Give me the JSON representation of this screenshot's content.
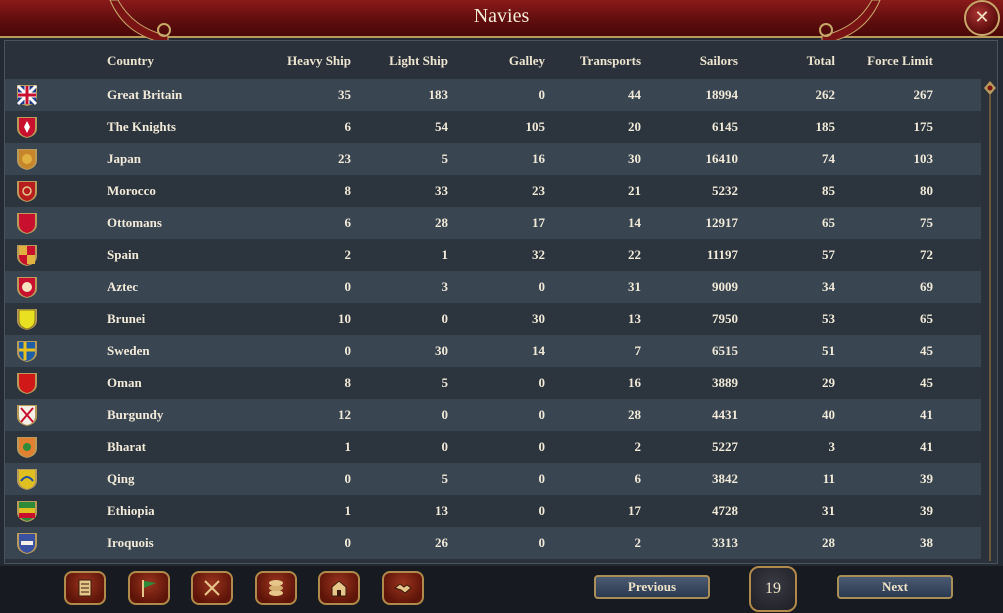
{
  "window": {
    "title": "Navies"
  },
  "columns": [
    "Country",
    "Heavy Ship",
    "Light Ship",
    "Galley",
    "Transports",
    "Sailors",
    "Total",
    "Force Limit"
  ],
  "rows": [
    {
      "flag": "great-britain-flag-icon",
      "country": "Great Britain",
      "heavy": "35",
      "light": "183",
      "galley": "0",
      "transports": "44",
      "sailors": "18994",
      "total": "262",
      "force_limit": "267"
    },
    {
      "flag": "knights-flag-icon",
      "country": "The Knights",
      "heavy": "6",
      "light": "54",
      "galley": "105",
      "transports": "20",
      "sailors": "6145",
      "total": "185",
      "force_limit": "175"
    },
    {
      "flag": "japan-flag-icon",
      "country": "Japan",
      "heavy": "23",
      "light": "5",
      "galley": "16",
      "transports": "30",
      "sailors": "16410",
      "total": "74",
      "force_limit": "103"
    },
    {
      "flag": "morocco-flag-icon",
      "country": "Morocco",
      "heavy": "8",
      "light": "33",
      "galley": "23",
      "transports": "21",
      "sailors": "5232",
      "total": "85",
      "force_limit": "80"
    },
    {
      "flag": "ottomans-flag-icon",
      "country": "Ottomans",
      "heavy": "6",
      "light": "28",
      "galley": "17",
      "transports": "14",
      "sailors": "12917",
      "total": "65",
      "force_limit": "75"
    },
    {
      "flag": "spain-flag-icon",
      "country": "Spain",
      "heavy": "2",
      "light": "1",
      "galley": "32",
      "transports": "22",
      "sailors": "11197",
      "total": "57",
      "force_limit": "72"
    },
    {
      "flag": "aztec-flag-icon",
      "country": "Aztec",
      "heavy": "0",
      "light": "3",
      "galley": "0",
      "transports": "31",
      "sailors": "9009",
      "total": "34",
      "force_limit": "69"
    },
    {
      "flag": "brunei-flag-icon",
      "country": "Brunei",
      "heavy": "10",
      "light": "0",
      "galley": "30",
      "transports": "13",
      "sailors": "7950",
      "total": "53",
      "force_limit": "65"
    },
    {
      "flag": "sweden-flag-icon",
      "country": "Sweden",
      "heavy": "0",
      "light": "30",
      "galley": "14",
      "transports": "7",
      "sailors": "6515",
      "total": "51",
      "force_limit": "45"
    },
    {
      "flag": "oman-flag-icon",
      "country": "Oman",
      "heavy": "8",
      "light": "5",
      "galley": "0",
      "transports": "16",
      "sailors": "3889",
      "total": "29",
      "force_limit": "45"
    },
    {
      "flag": "burgundy-flag-icon",
      "country": "Burgundy",
      "heavy": "12",
      "light": "0",
      "galley": "0",
      "transports": "28",
      "sailors": "4431",
      "total": "40",
      "force_limit": "41"
    },
    {
      "flag": "bharat-flag-icon",
      "country": "Bharat",
      "heavy": "1",
      "light": "0",
      "galley": "0",
      "transports": "2",
      "sailors": "5227",
      "total": "3",
      "force_limit": "41"
    },
    {
      "flag": "qing-flag-icon",
      "country": "Qing",
      "heavy": "0",
      "light": "5",
      "galley": "0",
      "transports": "6",
      "sailors": "3842",
      "total": "11",
      "force_limit": "39"
    },
    {
      "flag": "ethiopia-flag-icon",
      "country": "Ethiopia",
      "heavy": "1",
      "light": "13",
      "galley": "0",
      "transports": "17",
      "sailors": "4728",
      "total": "31",
      "force_limit": "39"
    },
    {
      "flag": "iroquois-flag-icon",
      "country": "Iroquois",
      "heavy": "0",
      "light": "26",
      "galley": "0",
      "transports": "2",
      "sailors": "3313",
      "total": "28",
      "force_limit": "38"
    }
  ],
  "bottom_bar": {
    "buttons": [
      "ledger-icon",
      "flag-icon",
      "crossed-swords-icon",
      "coins-icon",
      "buildings-icon",
      "handshake-icon"
    ],
    "previous_label": "Previous",
    "next_label": "Next",
    "page_number": "19"
  },
  "colors": {
    "title_bar": "#6e1010",
    "gold_trim": "#b89a5a",
    "row_dark": "#2c343e",
    "row_light": "#3a4552"
  }
}
